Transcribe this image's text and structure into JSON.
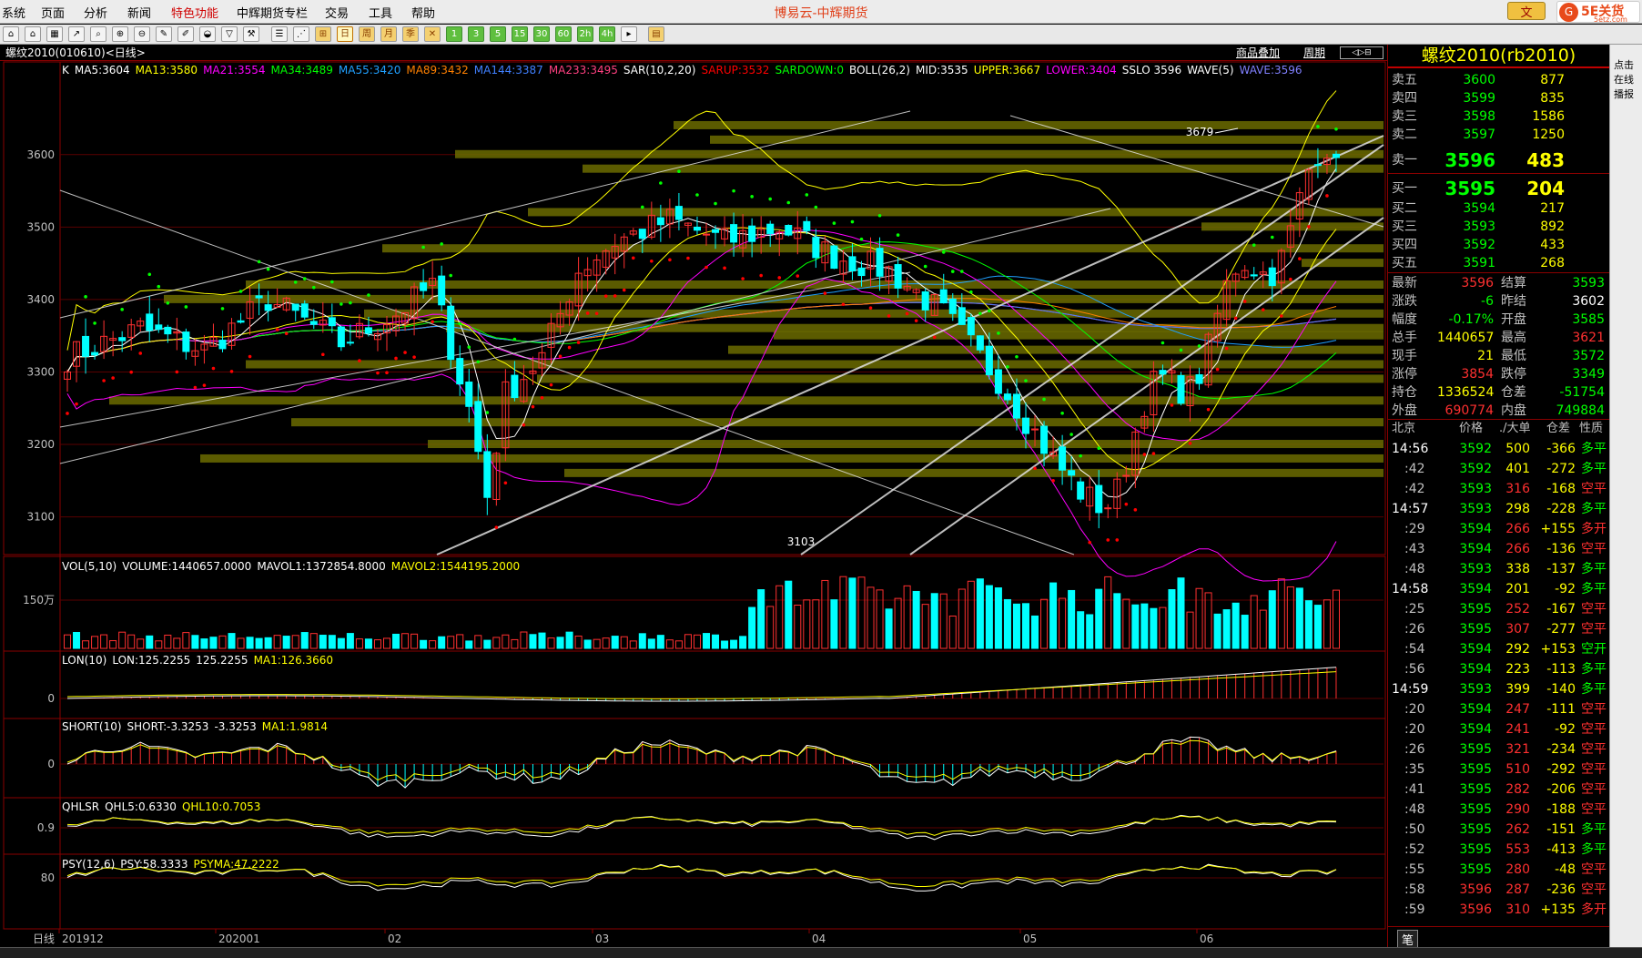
{
  "window": {
    "title": "博易云-中辉期货",
    "brand_badge": "5E关货",
    "brand_url": "5etz.com",
    "close_btn": "文"
  },
  "menus": [
    "系统",
    "页面",
    "分析",
    "新闻",
    "特色功能",
    "中辉期货专栏",
    "交易",
    "工具",
    "帮助"
  ],
  "toolbar": {
    "buttons": [
      "1",
      "3",
      "5",
      "15",
      "30",
      "60",
      "2h",
      "4h"
    ],
    "day_labels": [
      "日",
      "周",
      "月",
      "季"
    ]
  },
  "chart_header": {
    "instrument_label": "螺纹2010(010610)<日线>",
    "product_overlay": "商品叠加",
    "period_btn": "周期"
  },
  "main_legend": [
    {
      "text": "K",
      "color": "#ffffff"
    },
    {
      "text": "MA5:3604",
      "color": "#ffffff"
    },
    {
      "text": "MA13:3580",
      "color": "#ffff00"
    },
    {
      "text": "MA21:3554",
      "color": "#ff00ff"
    },
    {
      "text": "MA34:3489",
      "color": "#00ff00"
    },
    {
      "text": "MA55:3420",
      "color": "#20a0ff"
    },
    {
      "text": "MA89:3432",
      "color": "#ff8000"
    },
    {
      "text": "MA144:3387",
      "color": "#4080ff"
    },
    {
      "text": "MA233:3495",
      "color": "#ff4080"
    },
    {
      "text": "SAR(10,2,20)",
      "color": "#ffffff"
    },
    {
      "text": "SARUP:3532",
      "color": "#ff0000"
    },
    {
      "text": "SARDOWN:0",
      "color": "#00ff00"
    },
    {
      "text": "BOLL(26,2)",
      "color": "#ffffff"
    },
    {
      "text": "MID:3535",
      "color": "#ffffff"
    },
    {
      "text": "UPPER:3667",
      "color": "#ffff00"
    },
    {
      "text": "LOWER:3404",
      "color": "#ff00ff"
    },
    {
      "text": "SSLO 3596",
      "color": "#ffffff"
    },
    {
      "text": "WAVE(5)",
      "color": "#ffffff"
    },
    {
      "text": "WAVE:3596",
      "color": "#8080ff"
    }
  ],
  "price_axis": [
    "3600",
    "3500",
    "3400",
    "3300",
    "3200",
    "3100"
  ],
  "annotations": {
    "high": "3679",
    "low": "3103"
  },
  "colors": {
    "up": "#ff3030",
    "down": "#00ffff",
    "volume_bar": "#ff3030",
    "accent_red": "#ff0000",
    "accent_green": "#00ff00",
    "accent_yellow": "#ffff00"
  },
  "vol_panel": {
    "axis": "150万",
    "legend": [
      {
        "text": "VOL(5,10)",
        "color": "#ffffff"
      },
      {
        "text": "VOLUME:1440657.0000",
        "color": "#ffffff"
      },
      {
        "text": "MAVOL1:1372854.8000",
        "color": "#ffffff"
      },
      {
        "text": "MAVOL2:1544195.2000",
        "color": "#ffff00"
      }
    ]
  },
  "lon_panel": {
    "axis": "0",
    "legend": [
      {
        "text": "LON(10)",
        "color": "#ffffff"
      },
      {
        "text": "LON:125.2255",
        "color": "#ffffff"
      },
      {
        "text": "125.2255",
        "color": "#ffffff"
      },
      {
        "text": "MA1:126.3660",
        "color": "#ffff00"
      }
    ]
  },
  "short_panel": {
    "axis": "0",
    "legend": [
      {
        "text": "SHORT(10)",
        "color": "#ffffff"
      },
      {
        "text": "SHORT:-3.3253",
        "color": "#ffffff"
      },
      {
        "text": "-3.3253",
        "color": "#ffffff"
      },
      {
        "text": "MA1:1.9814",
        "color": "#ffff00"
      }
    ]
  },
  "qhlsr_panel": {
    "axis": "0.9",
    "legend": [
      {
        "text": "QHLSR",
        "color": "#ffffff"
      },
      {
        "text": "QHL5:0.6330",
        "color": "#ffffff"
      },
      {
        "text": "QHL10:0.7053",
        "color": "#ffff00"
      }
    ]
  },
  "psy_panel": {
    "axis": "80",
    "legend": [
      {
        "text": "PSY(12,6)",
        "color": "#ffffff"
      },
      {
        "text": "PSY:58.3333",
        "color": "#ffffff"
      },
      {
        "text": "PSYMA:47.2222",
        "color": "#ffff00"
      }
    ]
  },
  "date_axis": [
    "日线",
    "201912",
    "202001",
    "02",
    "03",
    "04",
    "05",
    "06"
  ],
  "quote": {
    "title": "螺纹2010(rb2010)",
    "asks": [
      {
        "label": "卖五",
        "price": "3600",
        "vol": "877"
      },
      {
        "label": "卖四",
        "price": "3599",
        "vol": "835"
      },
      {
        "label": "卖三",
        "price": "3598",
        "vol": "1586"
      },
      {
        "label": "卖二",
        "price": "3597",
        "vol": "1250"
      },
      {
        "label": "卖一",
        "price": "3596",
        "vol": "483"
      }
    ],
    "bids": [
      {
        "label": "买一",
        "price": "3595",
        "vol": "204"
      },
      {
        "label": "买二",
        "price": "3594",
        "vol": "217"
      },
      {
        "label": "买三",
        "price": "3593",
        "vol": "892"
      },
      {
        "label": "买四",
        "price": "3592",
        "vol": "433"
      },
      {
        "label": "买五",
        "price": "3591",
        "vol": "268"
      }
    ],
    "stats": [
      {
        "l1": "最新",
        "v1": "3596",
        "c1": "#ff3030",
        "l2": "结算",
        "v2": "3593",
        "c2": "#00ff00"
      },
      {
        "l1": "涨跌",
        "v1": "-6",
        "c1": "#00ff00",
        "l2": "昨结",
        "v2": "3602",
        "c2": "#ffffff"
      },
      {
        "l1": "幅度",
        "v1": "-0.17%",
        "c1": "#00ff00",
        "l2": "开盘",
        "v2": "3585",
        "c2": "#00ff00"
      },
      {
        "l1": "总手",
        "v1": "1440657",
        "c1": "#ffff00",
        "l2": "最高",
        "v2": "3621",
        "c2": "#ff3030"
      },
      {
        "l1": "现手",
        "v1": "21",
        "c1": "#ffff00",
        "l2": "最低",
        "v2": "3572",
        "c2": "#00ff00"
      },
      {
        "l1": "涨停",
        "v1": "3854",
        "c1": "#ff3030",
        "l2": "跌停",
        "v2": "3349",
        "c2": "#00ff00"
      },
      {
        "l1": "持仓",
        "v1": "1336524",
        "c1": "#ffff00",
        "l2": "仓差",
        "v2": "-51754",
        "c2": "#00ff00"
      },
      {
        "l1": "外盘",
        "v1": "690774",
        "c1": "#ff3030",
        "l2": "内盘",
        "v2": "749884",
        "c2": "#00ff00"
      }
    ],
    "tick_header": {
      "loc": "北京",
      "price": "价格",
      "vol": "./大单",
      "oi": "仓差",
      "nature": "性质"
    },
    "ticks": [
      {
        "t": "14:56",
        "p": "3592",
        "v": "500",
        "d": "-366",
        "n": "多平",
        "pc": "#00ff00",
        "vc": "#ffff00",
        "nc": "#00ff00"
      },
      {
        "t": ":42",
        "p": "3592",
        "v": "401",
        "d": "-272",
        "n": "多平",
        "pc": "#00ff00",
        "vc": "#ffff00",
        "nc": "#00ff00"
      },
      {
        "t": ":42",
        "p": "3593",
        "v": "316",
        "d": "-168",
        "n": "空平",
        "pc": "#00ff00",
        "vc": "#ff3030",
        "nc": "#ff3030"
      },
      {
        "t": "14:57",
        "p": "3593",
        "v": "298",
        "d": "-228",
        "n": "多平",
        "pc": "#00ff00",
        "vc": "#ffff00",
        "nc": "#00ff00"
      },
      {
        "t": ":29",
        "p": "3594",
        "v": "266",
        "d": "+155",
        "n": "多开",
        "pc": "#00ff00",
        "vc": "#ff3030",
        "nc": "#ff3030"
      },
      {
        "t": ":43",
        "p": "3594",
        "v": "266",
        "d": "-136",
        "n": "空平",
        "pc": "#00ff00",
        "vc": "#ff3030",
        "nc": "#ff3030"
      },
      {
        "t": ":48",
        "p": "3593",
        "v": "338",
        "d": "-137",
        "n": "多平",
        "pc": "#00ff00",
        "vc": "#ffff00",
        "nc": "#00ff00"
      },
      {
        "t": "14:58",
        "p": "3594",
        "v": "201",
        "d": "-92",
        "n": "多平",
        "pc": "#00ff00",
        "vc": "#ffff00",
        "nc": "#00ff00"
      },
      {
        "t": ":25",
        "p": "3595",
        "v": "252",
        "d": "-167",
        "n": "空平",
        "pc": "#00ff00",
        "vc": "#ff3030",
        "nc": "#ff3030"
      },
      {
        "t": ":26",
        "p": "3595",
        "v": "307",
        "d": "-277",
        "n": "空平",
        "pc": "#00ff00",
        "vc": "#ff3030",
        "nc": "#ff3030"
      },
      {
        "t": ":54",
        "p": "3594",
        "v": "292",
        "d": "+153",
        "n": "空开",
        "pc": "#00ff00",
        "vc": "#ffff00",
        "nc": "#00ff00"
      },
      {
        "t": ":56",
        "p": "3594",
        "v": "223",
        "d": "-113",
        "n": "多平",
        "pc": "#00ff00",
        "vc": "#ffff00",
        "nc": "#00ff00"
      },
      {
        "t": "14:59",
        "p": "3593",
        "v": "399",
        "d": "-140",
        "n": "多平",
        "pc": "#00ff00",
        "vc": "#ffff00",
        "nc": "#00ff00"
      },
      {
        "t": ":20",
        "p": "3594",
        "v": "247",
        "d": "-111",
        "n": "空平",
        "pc": "#00ff00",
        "vc": "#ff3030",
        "nc": "#ff3030"
      },
      {
        "t": ":20",
        "p": "3594",
        "v": "241",
        "d": "-92",
        "n": "空平",
        "pc": "#00ff00",
        "vc": "#ff3030",
        "nc": "#ff3030"
      },
      {
        "t": ":26",
        "p": "3595",
        "v": "321",
        "d": "-234",
        "n": "空平",
        "pc": "#00ff00",
        "vc": "#ff3030",
        "nc": "#ff3030"
      },
      {
        "t": ":35",
        "p": "3595",
        "v": "510",
        "d": "-292",
        "n": "空平",
        "pc": "#00ff00",
        "vc": "#ff3030",
        "nc": "#ff3030"
      },
      {
        "t": ":41",
        "p": "3595",
        "v": "282",
        "d": "-206",
        "n": "空平",
        "pc": "#00ff00",
        "vc": "#ff3030",
        "nc": "#ff3030"
      },
      {
        "t": ":48",
        "p": "3595",
        "v": "290",
        "d": "-188",
        "n": "空平",
        "pc": "#00ff00",
        "vc": "#ff3030",
        "nc": "#ff3030"
      },
      {
        "t": ":50",
        "p": "3595",
        "v": "262",
        "d": "-151",
        "n": "多平",
        "pc": "#00ff00",
        "vc": "#ff3030",
        "nc": "#00ff00"
      },
      {
        "t": ":52",
        "p": "3595",
        "v": "553",
        "d": "-413",
        "n": "多平",
        "pc": "#00ff00",
        "vc": "#ff3030",
        "nc": "#00ff00"
      },
      {
        "t": ":55",
        "p": "3595",
        "v": "280",
        "d": "-48",
        "n": "空平",
        "pc": "#00ff00",
        "vc": "#ff3030",
        "nc": "#ff3030"
      },
      {
        "t": ":58",
        "p": "3596",
        "v": "287",
        "d": "-236",
        "n": "空平",
        "pc": "#ff3030",
        "vc": "#ff3030",
        "nc": "#ff3030"
      },
      {
        "t": ":59",
        "p": "3596",
        "v": "310",
        "d": "+135",
        "n": "多开",
        "pc": "#ff3030",
        "vc": "#ff3030",
        "nc": "#ff3030"
      }
    ],
    "footer_tab": "笔"
  },
  "rightstrip": {
    "lines": [
      "点击",
      "在线",
      "播报"
    ]
  }
}
